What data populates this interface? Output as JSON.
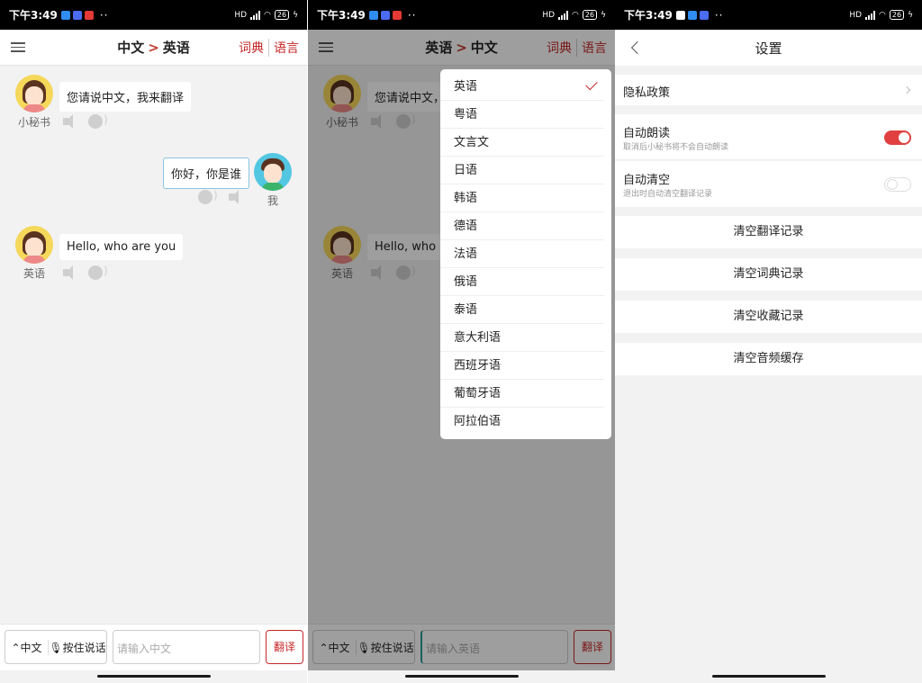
{
  "status": {
    "time": "下午3:49",
    "battery": "26",
    "network": "HD"
  },
  "screen1": {
    "title_from": "中文",
    "title_arrow": ">",
    "title_to": "英语",
    "dict_label": "词典",
    "lang_label": "语言",
    "messages": [
      {
        "speaker": "小秘书",
        "text": "您请说中文，我来翻译"
      },
      {
        "speaker": "我",
        "text": "你好，你是谁"
      },
      {
        "speaker": "英语",
        "text": "Hello, who are you"
      }
    ],
    "bottom": {
      "lang": "中文",
      "hold": "按住说话",
      "placeholder": "请输入中文",
      "translate": "翻译"
    }
  },
  "screen2": {
    "title_from": "英语",
    "title_arrow": ">",
    "title_to": "中文",
    "dict_label": "词典",
    "lang_label": "语言",
    "messages": [
      {
        "speaker": "小秘书",
        "text": "您请说中文，我来翻"
      },
      {
        "speaker": "英语",
        "text": "Hello, who a"
      }
    ],
    "languages": [
      "英语",
      "粤语",
      "文言文",
      "日语",
      "韩语",
      "德语",
      "法语",
      "俄语",
      "泰语",
      "意大利语",
      "西班牙语",
      "葡萄牙语",
      "阿拉伯语"
    ],
    "selected": "英语",
    "bottom": {
      "lang": "中文",
      "hold": "按住说话",
      "placeholder": "请输入英语",
      "translate": "翻译"
    }
  },
  "screen3": {
    "title": "设置",
    "privacy": "隐私政策",
    "auto_read": {
      "label": "自动朗读",
      "desc": "取消后小秘书将不会自动朗读",
      "on": true
    },
    "auto_clear": {
      "label": "自动清空",
      "desc": "退出时自动清空翻译记录",
      "on": false
    },
    "actions": [
      "清空翻译记录",
      "清空词典记录",
      "清空收藏记录",
      "清空音频缓存"
    ]
  },
  "colors": {
    "accent": "#c62828",
    "toggle_on": "#e04040",
    "bubble_border": "#8ac6e0"
  }
}
